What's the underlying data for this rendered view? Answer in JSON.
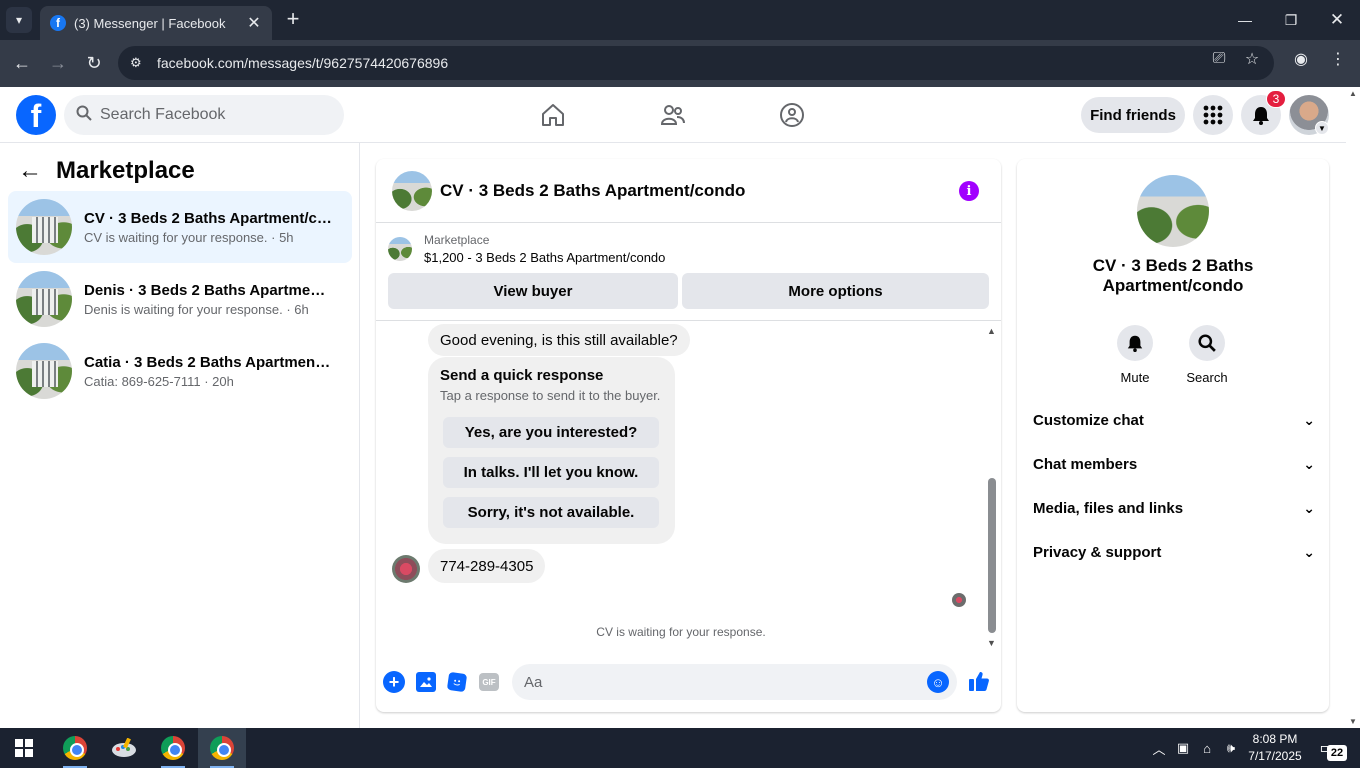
{
  "browser": {
    "tab_title": "(3) Messenger | Facebook",
    "tab_close": "✕",
    "new_tab": "+",
    "url": "facebook.com/messages/t/9627574420676896"
  },
  "fb": {
    "search_placeholder": "Search Facebook",
    "find_friends": "Find friends",
    "notification_count": "3"
  },
  "left": {
    "title": "Marketplace",
    "conversations": [
      {
        "name": "CV · 3 Beds 2 Baths Apartment/co...",
        "sub": "CV is waiting for your response. · 5h"
      },
      {
        "name": "Denis · 3 Beds 2 Baths Apartment/...",
        "sub": "Denis is waiting for your response. · 6h"
      },
      {
        "name": "Catia · 3 Beds 2 Baths Apartment/...",
        "sub": "Catia: 869-625-7111 · 20h"
      }
    ]
  },
  "chat": {
    "title": "CV · 3 Beds 2 Baths Apartment/condo",
    "listing_category": "Marketplace",
    "listing_price": "$1,200 - 3 Beds 2 Baths Apartment/condo",
    "view_buyer": "View buyer",
    "more_options": "More options",
    "message1": "Good evening, is this still available?",
    "quick_title": "Send a quick response",
    "quick_sub": "Tap a response to send it to the buyer.",
    "quick_replies": [
      "Yes, are you interested?",
      "In talks. I'll let you know.",
      "Sorry, it's not available."
    ],
    "message2": "774-289-4305",
    "waiting": "CV is waiting for your response.",
    "input_placeholder": "Aa",
    "gif_label": "GIF"
  },
  "right": {
    "name": "CV · 3 Beds 2 Baths Apartment/condo",
    "mute": "Mute",
    "search": "Search",
    "sections": [
      "Customize chat",
      "Chat members",
      "Media, files and links",
      "Privacy & support"
    ]
  },
  "taskbar": {
    "time": "8:08 PM",
    "date": "7/17/2025",
    "notifications": "22"
  },
  "colors": {
    "brand": "#0866ff",
    "info": "#a100ff",
    "badge": "#e41e3f"
  }
}
